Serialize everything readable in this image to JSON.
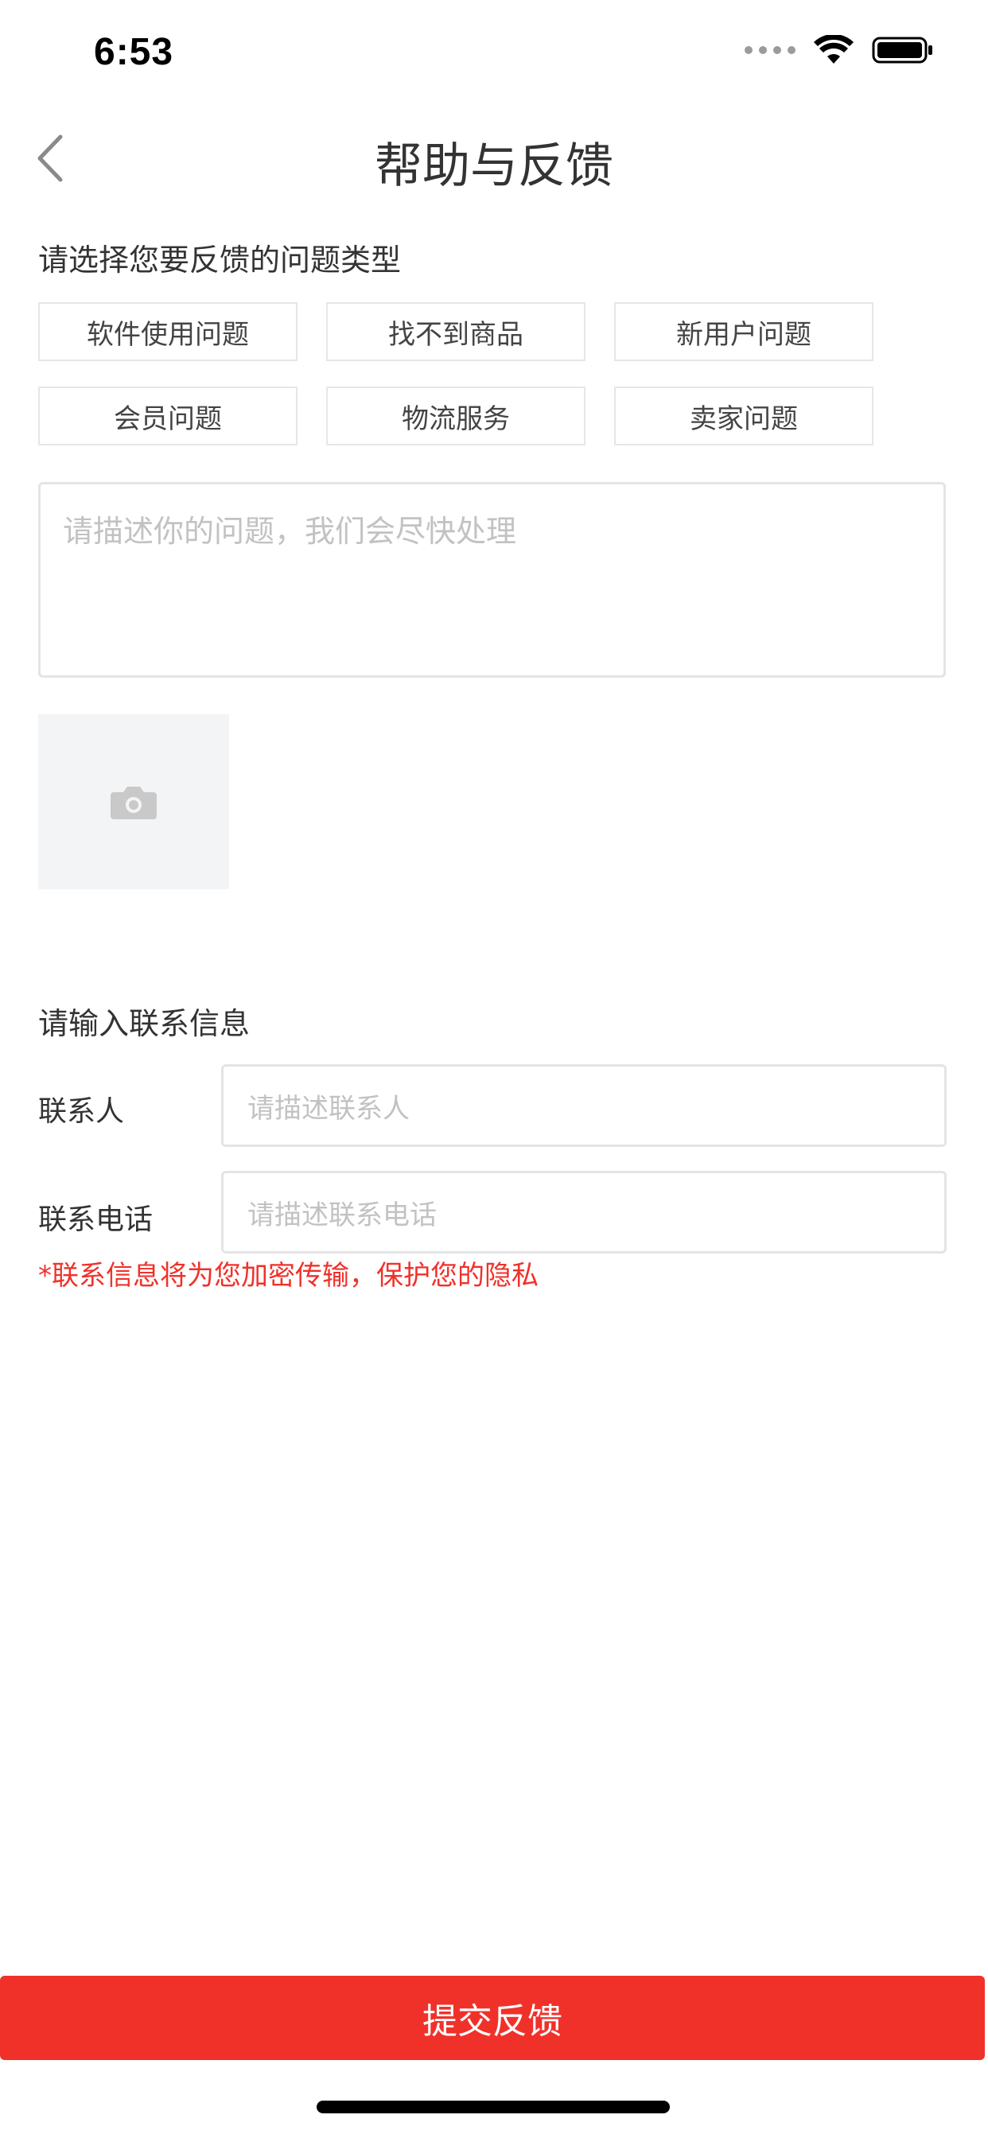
{
  "status_bar": {
    "time": "6:53",
    "icons": [
      "signal-icon",
      "wifi-icon",
      "battery-icon"
    ]
  },
  "nav": {
    "title": "帮助与反馈",
    "back_icon": "chevron-left-icon"
  },
  "problem_type": {
    "heading": "请选择您要反馈的问题类型",
    "options": [
      "软件使用问题",
      "找不到商品",
      "新用户问题",
      "会员问题",
      "物流服务",
      "卖家问题"
    ]
  },
  "description": {
    "placeholder": "请描述你的问题，我们会尽快处理"
  },
  "photo": {
    "icon": "camera-icon"
  },
  "contact": {
    "heading": "请输入联系信息",
    "name_label": "联系人",
    "name_placeholder": "请描述联系人",
    "phone_label": "联系电话",
    "phone_placeholder": "请描述联系电话",
    "privacy_note": "*联系信息将为您加密传输，保护您的隐私"
  },
  "submit": {
    "label": "提交反馈"
  },
  "colors": {
    "accent": "#f0312a",
    "placeholder": "#c2c2c2",
    "border": "#e4e4e4",
    "photo_bg": "#f3f4f5"
  }
}
